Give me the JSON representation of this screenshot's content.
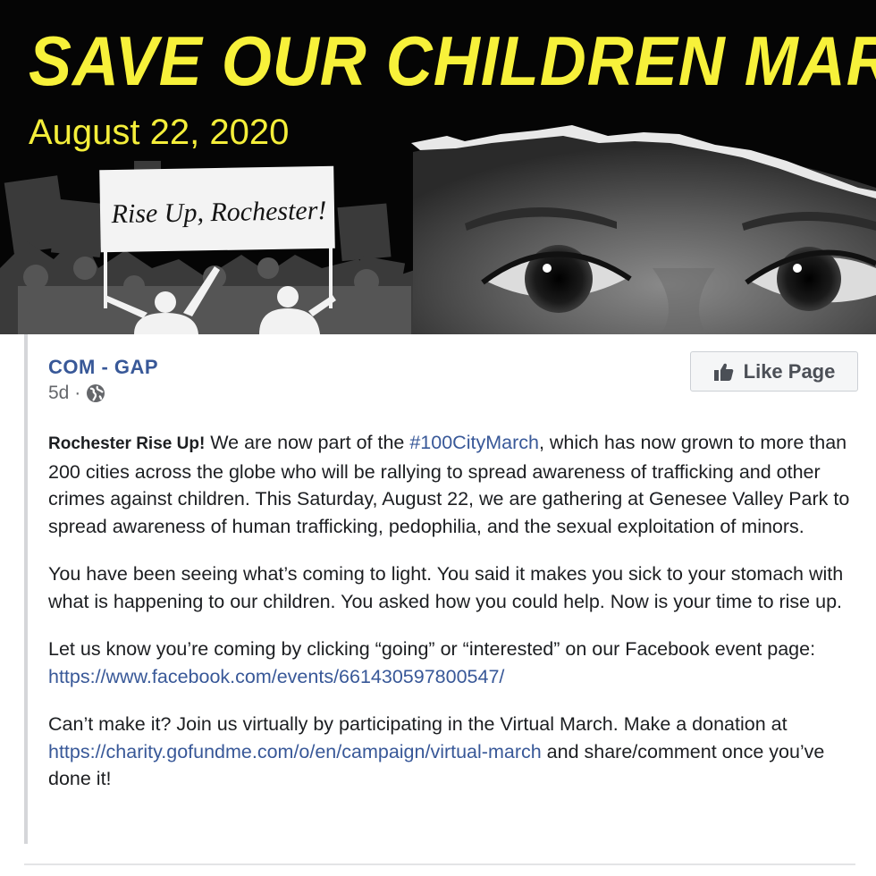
{
  "banner": {
    "title": "SAVE OUR CHILDREN MARCH",
    "date": "August 22, 2020",
    "sign_text": "Rise Up, Rochester!"
  },
  "post": {
    "page_name": "COM - GAP",
    "time": "5d ·",
    "like_label": "Like Page",
    "p1": {
      "lead": "Rochester Rise Up!",
      "t1": " We are now part of the ",
      "hashtag": "#100CityMarch",
      "t2": ", which has now grown to more than 200 cities across the globe who will be rallying to spread awareness of trafficking and other crimes against children. This Saturday, August 22, we are gathering at Genesee Valley Park to spread awareness of human trafficking, pedophilia, and the sexual exploitation of minors."
    },
    "p2": "You have been seeing what’s coming to light. You said it makes you sick to your stomach with what is happening to our children. You asked how you could help. Now is your time to rise up.",
    "p3": {
      "t1": "Let us know you’re coming by clicking “going” or “interested” on our Facebook event page: ",
      "link": "https://www.facebook.com/events/661430597800547/"
    },
    "p4": {
      "t1": "Can’t make it? Join us virtually by participating in the Virtual March. Make a donation at ",
      "link": "https://charity.gofundme.com/o/en/campaign/virtual-march",
      "t2": " and share/comment once you’ve done it!"
    }
  },
  "icons": {
    "globe": "globe-icon",
    "like": "thumbs-up-icon"
  },
  "colors": {
    "banner_yellow": "#f7f13a",
    "link": "#385898",
    "text": "#1c1e21",
    "meta": "#65676b"
  }
}
